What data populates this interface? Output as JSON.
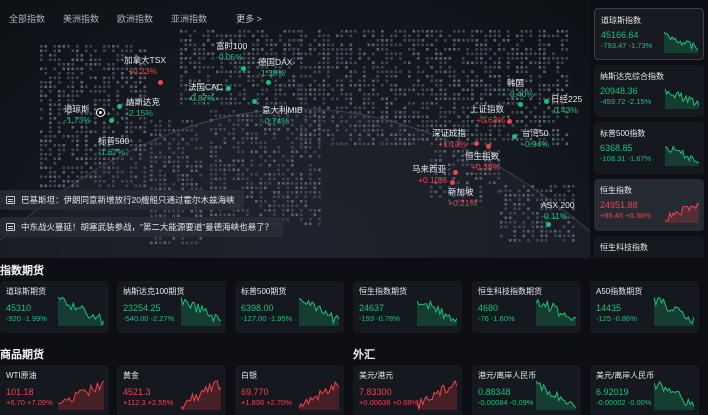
{
  "tabs": [
    {
      "label": "全部指数",
      "active": true
    },
    {
      "label": "美洲指数",
      "active": false
    },
    {
      "label": "欧洲指数",
      "active": false
    },
    {
      "label": "亚洲指数",
      "active": false
    }
  ],
  "more_label": "更多 >",
  "map_markers": [
    {
      "id": "tsx",
      "name": "加拿大TSX",
      "change": "+0.23%",
      "dir": "up"
    },
    {
      "id": "ftse",
      "name": "富时100",
      "change": "-0.05%",
      "dir": "dn"
    },
    {
      "id": "dax",
      "name": "德国DAX",
      "change": "-1.38%",
      "dir": "dn"
    },
    {
      "id": "dow",
      "name": "道琼斯",
      "change": "-1.73%",
      "dir": "dn"
    },
    {
      "id": "nasdaq",
      "name": "纳斯达克",
      "change": "-2.15%",
      "dir": "dn"
    },
    {
      "id": "cac",
      "name": "法国CAC",
      "change": "-0.87%",
      "dir": "dn"
    },
    {
      "id": "mib",
      "name": "意大利MIB",
      "change": "-0.74%",
      "dir": "dn"
    },
    {
      "id": "sp500",
      "name": "标普500",
      "change": "-1.67%",
      "dir": "dn"
    },
    {
      "id": "korea",
      "name": "韩国",
      "change": "-0.40%",
      "dir": "dn"
    },
    {
      "id": "nikkei",
      "name": "日经225",
      "change": "-0.43%",
      "dir": "dn"
    },
    {
      "id": "sse",
      "name": "上证指数",
      "change": "+0.63%",
      "dir": "up"
    },
    {
      "id": "szse",
      "name": "深证成指",
      "change": "+1.13%",
      "dir": "up"
    },
    {
      "id": "taiwan",
      "name": "台湾50",
      "change": "-0.94%",
      "dir": "dn"
    },
    {
      "id": "hsi",
      "name": "恒生指数",
      "change": "+0.38%",
      "dir": "up"
    },
    {
      "id": "malaysia",
      "name": "马来西亚",
      "change": "+0.10%",
      "dir": "up"
    },
    {
      "id": "singapore",
      "name": "新加坡",
      "change": "+0.21%",
      "dir": "up"
    },
    {
      "id": "asx",
      "name": "ASX 200",
      "change": "-0.11%",
      "dir": "dn"
    }
  ],
  "news": [
    "巴基斯坦：伊朗同意新增放行20艘船只通过霍尔木兹海峡",
    "中东战火蔓延！胡塞武装参战，“第二大能源要道”曼德海峡也悬了？"
  ],
  "side_cards": [
    {
      "name": "道琼斯指数",
      "price": "45166.64",
      "change": "-793.47 -1.73%",
      "dir": "dn",
      "state": "sel"
    },
    {
      "name": "纳斯达克综合指数",
      "price": "20948.36",
      "change": "-459.72 -2.15%",
      "dir": "dn",
      "state": ""
    },
    {
      "name": "标普500指数",
      "price": "6368.85",
      "change": "-108.31 -1.67%",
      "dir": "dn",
      "state": ""
    },
    {
      "name": "恒生指数",
      "price": "24951.88",
      "change": "+95.45 +0.38%",
      "dir": "up",
      "state": "hl"
    },
    {
      "name": "恒生科技指数",
      "price": "",
      "change": "",
      "dir": "dn",
      "state": ""
    }
  ],
  "sections": {
    "index_futures": "指数期货",
    "commodity_futures": "商品期货",
    "forex": "外汇"
  },
  "index_futures": [
    {
      "name": "道琼斯期货",
      "price": "45310",
      "change": "-920 -1.99%",
      "dir": "dn"
    },
    {
      "name": "纳斯达克100期货",
      "price": "23254.25",
      "change": "-540.00 -2.27%",
      "dir": "dn"
    },
    {
      "name": "标普500期货",
      "price": "6398.00",
      "change": "-127.00 -1.95%",
      "dir": "dn"
    },
    {
      "name": "恒生指数期货",
      "price": "24637",
      "change": "-193 -0.78%",
      "dir": "dn"
    },
    {
      "name": "恒生科技指数期货",
      "price": "4680",
      "change": "-76 -1.60%",
      "dir": "dn"
    },
    {
      "name": "A50指数期货",
      "price": "14435",
      "change": "-125 -0.86%",
      "dir": "dn"
    }
  ],
  "commodity_futures": [
    {
      "name": "WTI原油",
      "price": "101.18",
      "change": "+6.70 +7.09%",
      "dir": "up"
    },
    {
      "name": "黄金",
      "price": "4521.3",
      "change": "+112.3 +2.55%",
      "dir": "up"
    },
    {
      "name": "白银",
      "price": "69.770",
      "change": "+1.836 +2.70%",
      "dir": "up"
    }
  ],
  "forex": [
    {
      "name": "美元/港元",
      "price": "7.83300",
      "change": "+0.00636 +0.08%",
      "dir": "up"
    },
    {
      "name": "港元/离岸人民币",
      "price": "0.88348",
      "change": "-0.00084 -0.09%",
      "dir": "dn"
    },
    {
      "name": "美元/离岸人民币",
      "price": "6.92019",
      "change": "-0.00002 -0.00%",
      "dir": "dn"
    }
  ],
  "colors": {
    "up": "#f0424a",
    "down": "#19c27a",
    "card": "#15181e",
    "background": "#0d0f14"
  }
}
